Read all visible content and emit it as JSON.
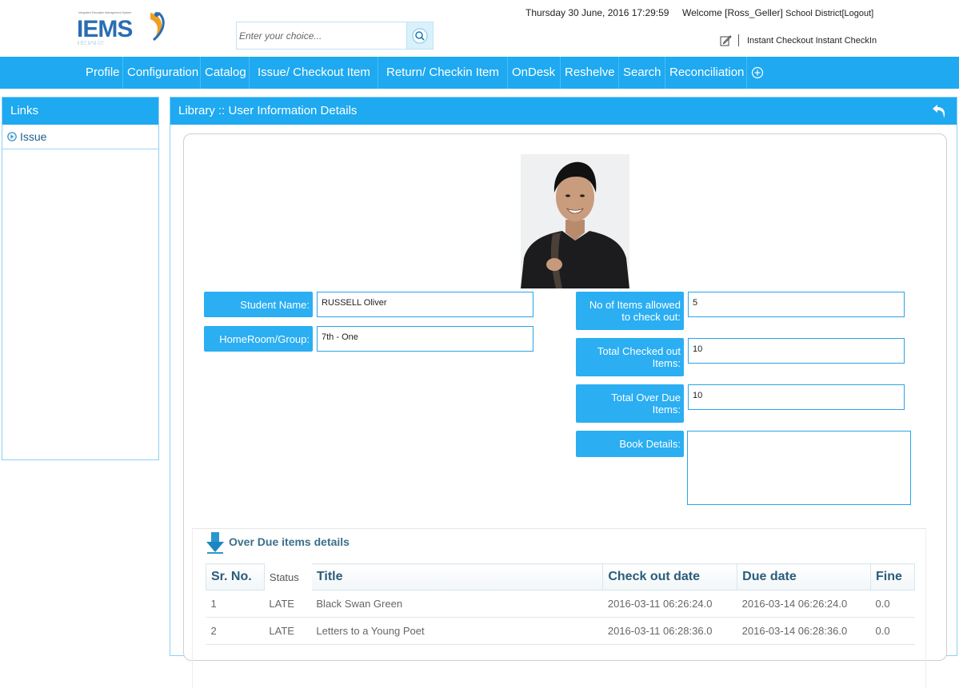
{
  "header": {
    "logo_text": "IEMS",
    "search": {
      "placeholder": "Enter your choice...",
      "value": ""
    },
    "datetime": "Thursday 30 June, 2016 17:29:59",
    "welcome_prefix": "Welcome [Ross_Geller]",
    "district": "School District",
    "logout": "[Logout]",
    "quick_links": [
      "Instant Checkout",
      "Instant CheckIn"
    ]
  },
  "nav": {
    "items": [
      "Profile",
      "Configuration",
      "Catalog",
      "Issue/ Checkout Item",
      "Return/ Checkin Item",
      "OnDesk",
      "Reshelve",
      "Search",
      "Reconciliation"
    ]
  },
  "sidebar": {
    "title": "Links",
    "items": [
      {
        "label": "Issue"
      }
    ]
  },
  "main": {
    "title": "Library :: User Information Details",
    "fields": {
      "student_name": {
        "label": "Student Name:",
        "value": "RUSSELL Oliver"
      },
      "homeroom": {
        "label": "HomeRoom/Group:",
        "value": "7th - One"
      },
      "items_allowed": {
        "label": "No of Items allowed to check out:",
        "value": "5"
      },
      "checked_out": {
        "label": "Total Checked out Items:",
        "value": "10"
      },
      "over_due": {
        "label": "Total Over Due Items:",
        "value": "10"
      },
      "book_details": {
        "label": "Book Details:",
        "value": ""
      }
    },
    "overdue": {
      "title": "Over Due items details",
      "columns": [
        "Sr. No.",
        "Status",
        "Title",
        "Check out date",
        "Due date",
        "Fine"
      ],
      "rows": [
        [
          "1",
          "LATE",
          "Black Swan Green",
          "2016-03-11 06:26:24.0",
          "2016-03-14 06:26:24.0",
          "0.0"
        ],
        [
          "2",
          "LATE",
          "Letters to a Young Poet",
          "2016-03-11 06:28:36.0",
          "2016-03-14 06:28:36.0",
          "0.0"
        ]
      ]
    }
  },
  "colors": {
    "accent": "#1ea9f0",
    "label_bg": "#2baef2",
    "heading": "#2b5d7a"
  }
}
